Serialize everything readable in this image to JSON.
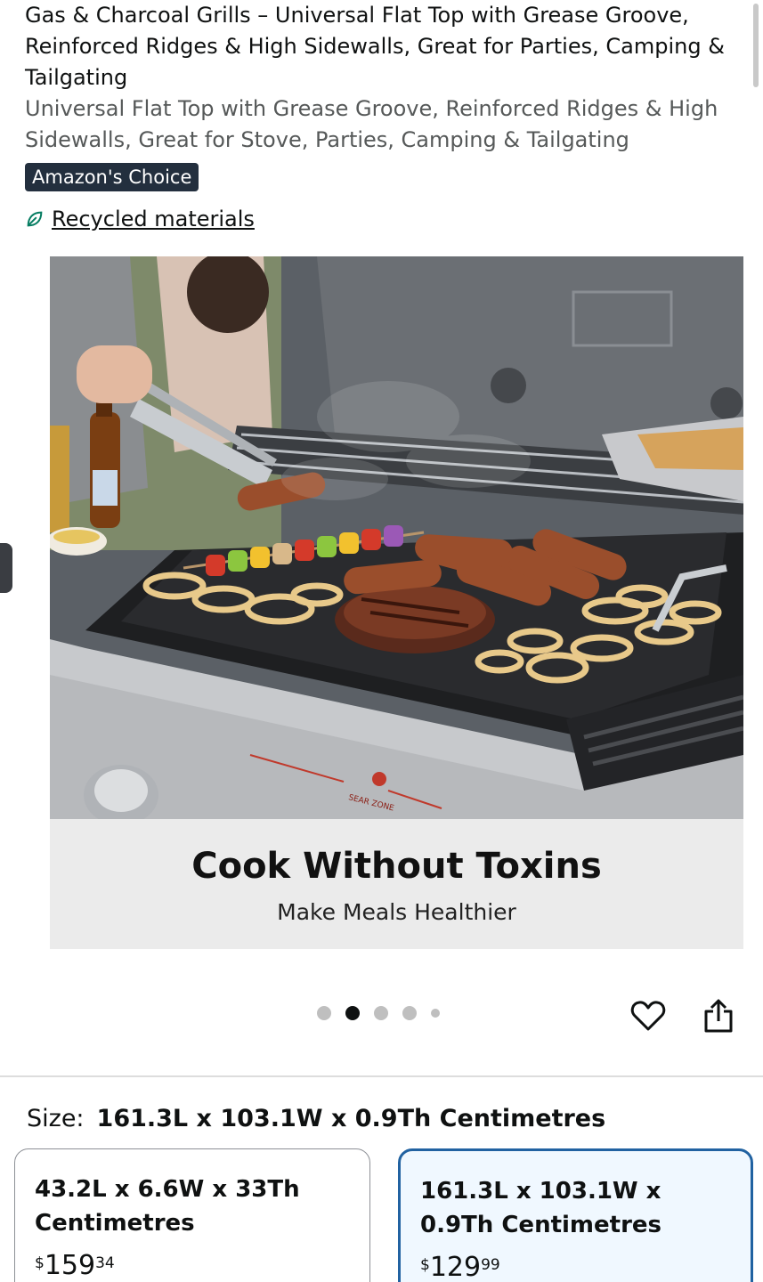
{
  "product": {
    "title": "Gas & Charcoal Grills – Universal Flat Top with Grease Groove, Reinforced Ridges & High Sidewalls, Great for Parties, Camping & Tailgating",
    "subtitle": "Universal Flat Top with Grease Groove, Reinforced Ridges & High Sidewalls, Great for Stove, Parties, Camping & Tailgating",
    "badge": "Amazon's Choice",
    "recycled_label": "Recycled materials"
  },
  "gallery": {
    "caption_title": "Cook Without Toxins",
    "caption_subtitle": "Make Meals Healthier",
    "grill_brand_text": "SEAR ZONE",
    "dots_count": 5,
    "active_dot_index": 1
  },
  "size": {
    "label": "Size:",
    "selected": "161.3L x 103.1W x 0.9Th Centimetres",
    "options": [
      {
        "name": "43.2L x 6.6W x 33Th Centimetres",
        "currency": "$",
        "whole": "159",
        "fraction": "34",
        "selected": false
      },
      {
        "name": "161.3L x 103.1W x 0.9Th Centimetres",
        "currency": "$",
        "whole": "129",
        "fraction": "99",
        "selected": true
      }
    ]
  },
  "icons": [
    "leaf-icon",
    "heart-icon",
    "share-icon"
  ],
  "colors": {
    "badge_bg": "#232f3e",
    "selected_border": "#2162a1",
    "selected_bg": "#f0f8ff"
  }
}
